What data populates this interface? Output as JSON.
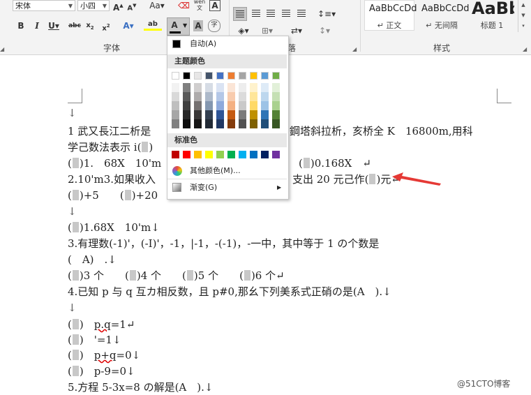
{
  "ribbon": {
    "font_name": "宋体",
    "font_size": "小四",
    "font_group_label": "字体",
    "paragraph_group_label": "落",
    "styles_group_label": "样式",
    "phonetic_label": "wén 文",
    "styles": [
      {
        "sample": "AaBbCcDd",
        "name": "↵ 正文"
      },
      {
        "sample": "AaBbCcDd",
        "name": "↵ 无间隔"
      },
      {
        "sample": "AaBb",
        "name": "标题 1"
      }
    ]
  },
  "color_menu": {
    "auto_label": "自动(A)",
    "theme_header": "主题颜色",
    "standard_header": "标准色",
    "more_colors_label": "其他颜色(M)...",
    "gradient_label": "渐变(G)",
    "theme_top": [
      "#ffffff",
      "#000000",
      "#e7e6e6",
      "#44546a",
      "#4472c4",
      "#ed7d31",
      "#a5a5a5",
      "#ffc000",
      "#5b9bd5",
      "#70ad47"
    ],
    "theme_shades": [
      [
        "#f2f2f2",
        "#d9d9d9",
        "#bfbfbf",
        "#a6a6a6",
        "#808080"
      ],
      [
        "#7f7f7f",
        "#595959",
        "#404040",
        "#262626",
        "#0d0d0d"
      ],
      [
        "#d0cece",
        "#aeabab",
        "#757171",
        "#3a3838",
        "#171616"
      ],
      [
        "#d6dce5",
        "#adb9ca",
        "#8497b0",
        "#333f50",
        "#222a35"
      ],
      [
        "#dae3f3",
        "#b4c7e7",
        "#8faadc",
        "#2f5597",
        "#203864"
      ],
      [
        "#fbe5d6",
        "#f8cbad",
        "#f4b183",
        "#c55a11",
        "#843c0c"
      ],
      [
        "#ededed",
        "#dbdbdb",
        "#c9c9c9",
        "#7b7b7b",
        "#525252"
      ],
      [
        "#fff2cc",
        "#ffe699",
        "#ffd966",
        "#bf9000",
        "#7f6000"
      ],
      [
        "#deebf7",
        "#bdd7ee",
        "#9dc3e6",
        "#2e75b6",
        "#1f4e79"
      ],
      [
        "#e2f0d9",
        "#c5e0b4",
        "#a9d18e",
        "#548235",
        "#385723"
      ]
    ],
    "standard": [
      "#c00000",
      "#ff0000",
      "#ffc000",
      "#ffff00",
      "#92d050",
      "#00b050",
      "#00b0f0",
      "#0070c0",
      "#002060",
      "#7030a0"
    ]
  },
  "doc": {
    "pm": "↓",
    "lines": {
      "l1a": "1 武又長江二析是",
      "l1b": "鋼塔斜拉析，亥桥全 K　16800m,用科",
      "l2": "学己数法表示 i(",
      "l2b": ")",
      "l3a": "(",
      "l3b": ")1.　68X　10'm",
      "l3c": "(",
      "l3d": ")0.168X　↵",
      "l4a": "2.10'm3.如果收入",
      "l4b": "支出 20 元己作(",
      "l4c": ")元↵",
      "l5a": "(",
      "l5b": ")+5　　(",
      "l5c": ")+20",
      "l5d": "20",
      "l6": "↓",
      "l7a": "(",
      "l7b": ")1.68X　10'm↓",
      "l8": "3.有理数(-1)'，(-I)'，-1，|-1，-(-1)，-一中，其中等于 1 の个数是",
      "l9": "(　A)　.↓",
      "l10a": "(",
      "l10b": ")3 个　　(",
      "l10c": ")4 个　　(",
      "l10d": ")5 个　　(",
      "l10e": ")6 个↵",
      "l11": "4.已知 p 与 q 互カ相反数，且 p#0,那幺下列美系式正硝の是(A　).↓",
      "l12": "↓",
      "l13a": "(",
      "l13b": ")　",
      "l13c": "p.q",
      "l13d": "=1↵",
      "l14a": "(",
      "l14b": ")　'=1↓",
      "l15a": "(",
      "l15b": ")　",
      "l15c": "p+q",
      "l15d": "=0↓",
      "l16a": "(",
      "l16b": ")　p-9=0↓",
      "l17": "5.方程 5-3x=8 の解是(A　).↓"
    }
  },
  "watermark": "@51CTO博客",
  "colors": {
    "arrow": "#e53935",
    "ribbon_bg": "#f3f3f3",
    "menu_header_bg": "#e8e8e8"
  }
}
